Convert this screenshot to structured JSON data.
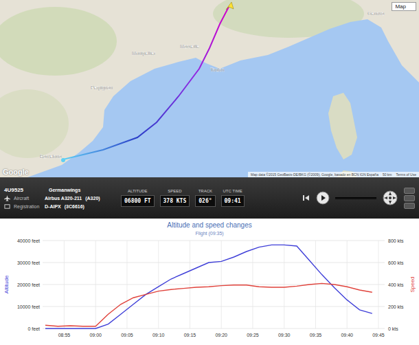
{
  "map": {
    "type_selector": "Map",
    "logo": "Google",
    "attribution": "Map data ©2015 GeoBasis-DE/BKG (©2009), Google, basado en BCN IGN España",
    "scale": "50 km",
    "terms": "Terms of Use",
    "labels": [
      "Montpellier",
      "Marseille",
      "Toulon",
      "Perpignan",
      "Barcelona",
      "Genova"
    ]
  },
  "flight": {
    "flight_id": "4U9525",
    "airline": "Germanwings",
    "aircraft_label": "Aircraft",
    "aircraft": "Airbus A320-211",
    "aircraft_code": "(A320)",
    "registration_label": "Registration",
    "registration": "D-AIPX",
    "registration_code": "(3C6616)"
  },
  "readouts": [
    {
      "label": "ALTITUDE",
      "value": "06800 FT"
    },
    {
      "label": "SPEED",
      "value": "378 KTS"
    },
    {
      "label": "TRACK",
      "value": "026°"
    },
    {
      "label": "UTC TIME",
      "value": "09:41"
    }
  ],
  "playback": {
    "playing": false
  },
  "chart": {
    "title": "Altitude and speed changes",
    "subtitle": "Flight (09:35)",
    "left_axis": {
      "label": "Altitude",
      "ticks": [
        "0 feet",
        "10000 feet",
        "20000 feet",
        "30000 feet",
        "40000 feet"
      ]
    },
    "right_axis": {
      "label": "Speed",
      "ticks": [
        "0 kts",
        "200 kts",
        "400 kts",
        "600 kts",
        "800 kts"
      ]
    },
    "x_ticks": [
      "08:55",
      "09:00",
      "09:05",
      "09:10",
      "09:15",
      "09:20",
      "09:25",
      "09:30",
      "09:35",
      "09:40",
      "09:45"
    ],
    "times": [
      "08:52",
      "08:54",
      "08:56",
      "08:58",
      "09:00",
      "09:02",
      "09:04",
      "09:06",
      "09:08",
      "09:10",
      "09:12",
      "09:14",
      "09:16",
      "09:18",
      "09:20",
      "09:22",
      "09:24",
      "09:26",
      "09:28",
      "09:30",
      "09:32",
      "09:34",
      "09:36",
      "09:38",
      "09:40",
      "09:42",
      "09:44"
    ],
    "series": [
      {
        "name": "Altitude",
        "axis": "left",
        "color": "#3f3fd8",
        "values": [
          0,
          0,
          0,
          0,
          0,
          2000,
          6500,
          11000,
          15500,
          19000,
          22500,
          25000,
          27500,
          30000,
          30500,
          32500,
          35000,
          37000,
          38000,
          38000,
          37500,
          31000,
          24500,
          18500,
          13000,
          8500,
          6800
        ]
      },
      {
        "name": "Speed",
        "axis": "right",
        "color": "#e0413a",
        "values": [
          30,
          20,
          25,
          20,
          20,
          130,
          220,
          280,
          310,
          340,
          355,
          365,
          375,
          380,
          390,
          395,
          395,
          380,
          375,
          375,
          385,
          400,
          410,
          400,
          380,
          350,
          330
        ]
      }
    ]
  }
}
